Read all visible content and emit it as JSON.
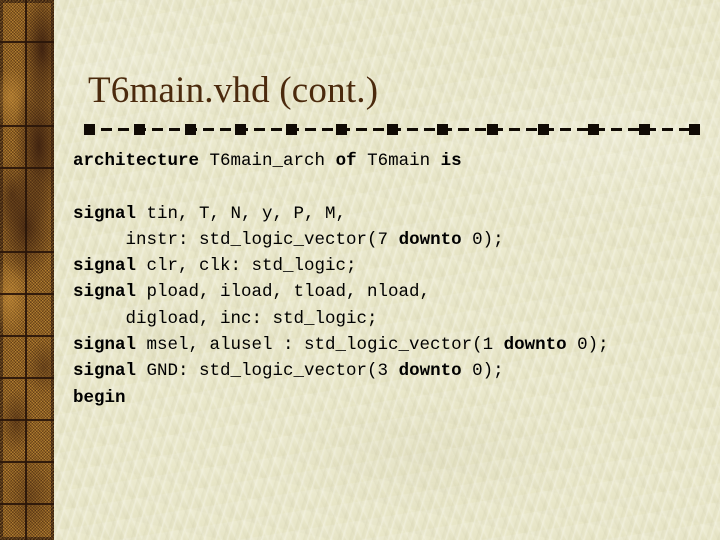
{
  "slide": {
    "title": "T6main.vhd (cont.)",
    "background_color": "#e9e7c8",
    "title_color": "#4b2a0d",
    "code_color": "#000000",
    "border_colors": [
      "#9a6a24",
      "#3a1e0e",
      "#1d1008"
    ],
    "divider": {
      "name": "dashed-divider",
      "dot_count": 13,
      "color": "#100a04"
    }
  },
  "code": {
    "lines": [
      {
        "indent": 0,
        "segments": [
          {
            "text": "architecture ",
            "bold": true
          },
          {
            "text": "T6main_arch ",
            "bold": false
          },
          {
            "text": "of ",
            "bold": true
          },
          {
            "text": "T6main ",
            "bold": false
          },
          {
            "text": "is",
            "bold": true
          }
        ]
      },
      {
        "indent": 0,
        "segments": []
      },
      {
        "indent": 0,
        "segments": [
          {
            "text": "signal ",
            "bold": true
          },
          {
            "text": "tin, T, N, y, P, M,",
            "bold": false
          }
        ]
      },
      {
        "indent": 0,
        "segments": [
          {
            "text": "     instr: std_logic_vector(7 ",
            "bold": false
          },
          {
            "text": "downto ",
            "bold": true
          },
          {
            "text": "0);",
            "bold": false
          }
        ]
      },
      {
        "indent": 0,
        "segments": [
          {
            "text": "signal ",
            "bold": true
          },
          {
            "text": "clr, clk: std_logic;",
            "bold": false
          }
        ]
      },
      {
        "indent": 0,
        "segments": [
          {
            "text": "signal ",
            "bold": true
          },
          {
            "text": "pload, iload, tload, nload,",
            "bold": false
          }
        ]
      },
      {
        "indent": 0,
        "segments": [
          {
            "text": "     digload, inc: std_logic;",
            "bold": false
          }
        ]
      },
      {
        "indent": 0,
        "segments": [
          {
            "text": "signal ",
            "bold": true
          },
          {
            "text": "msel, alusel : std_logic_vector(1 ",
            "bold": false
          },
          {
            "text": "downto ",
            "bold": true
          },
          {
            "text": "0);",
            "bold": false
          }
        ]
      },
      {
        "indent": 0,
        "segments": [
          {
            "text": "signal ",
            "bold": true
          },
          {
            "text": "GND: std_logic_vector(3 ",
            "bold": false
          },
          {
            "text": "downto ",
            "bold": true
          },
          {
            "text": "0);",
            "bold": false
          }
        ]
      },
      {
        "indent": 0,
        "segments": [
          {
            "text": "begin",
            "bold": true
          }
        ]
      }
    ]
  }
}
